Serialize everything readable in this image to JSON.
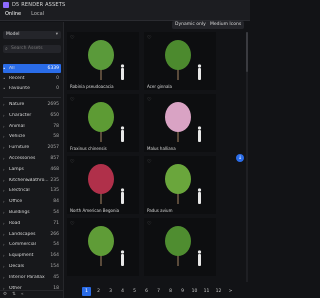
{
  "app": {
    "title": "D5 RENDER ASSETS"
  },
  "tabs": [
    {
      "label": "Online"
    },
    {
      "label": "Local"
    }
  ],
  "sidebar": {
    "category_select": "Model",
    "search_placeholder": "Search Assets",
    "top_items": [
      {
        "label": "All",
        "count": "6339",
        "active": true
      },
      {
        "label": "Recent",
        "count": "0"
      },
      {
        "label": "Favourite",
        "count": "0"
      }
    ],
    "items": [
      {
        "label": "Nature",
        "count": "2695"
      },
      {
        "label": "Character",
        "count": "650"
      },
      {
        "label": "Animal",
        "count": "78"
      },
      {
        "label": "Vehicle",
        "count": "58"
      },
      {
        "label": "Furniture",
        "count": "2057"
      },
      {
        "label": "Accessories",
        "count": "857"
      },
      {
        "label": "Lamps",
        "count": "468"
      },
      {
        "label": "Kitchen&Bathro...",
        "count": "235"
      },
      {
        "label": "Electrical",
        "count": "135"
      },
      {
        "label": "Office",
        "count": "84"
      },
      {
        "label": "Buildings",
        "count": "54"
      },
      {
        "label": "Road",
        "count": "71"
      },
      {
        "label": "Landscapes",
        "count": "266"
      },
      {
        "label": "Commercial",
        "count": "54"
      },
      {
        "label": "Equipment",
        "count": "164"
      },
      {
        "label": "Decals",
        "count": "154"
      },
      {
        "label": "Interior Parallax",
        "count": "45"
      },
      {
        "label": "Other",
        "count": "18"
      }
    ]
  },
  "filters": {
    "dynamic": "Dynamic only",
    "size": "Medium Icons"
  },
  "assets": [
    {
      "name": "Robinia pseudoacacia",
      "color": "#5a9a3a"
    },
    {
      "name": "Acer ginnala",
      "color": "#4c8a2e"
    },
    {
      "name": "Fraxinus chinensis",
      "color": "#5d9b34"
    },
    {
      "name": "Malus halliana",
      "color": "#d9a3c4"
    },
    {
      "name": "North American Begonia",
      "color": "#b0304a"
    },
    {
      "name": "Padus avium",
      "color": "#6aa63c"
    },
    {
      "name": "",
      "color": "#5f9c37"
    },
    {
      "name": "",
      "color": "#4f8d30"
    }
  ],
  "pagination": {
    "pages": [
      "1",
      "2",
      "3",
      "4",
      "5",
      "6",
      "7",
      "8",
      "9",
      "10",
      "11",
      "12"
    ],
    "current": "1",
    "next": ">"
  },
  "fab_icon": "arrow-down-icon"
}
